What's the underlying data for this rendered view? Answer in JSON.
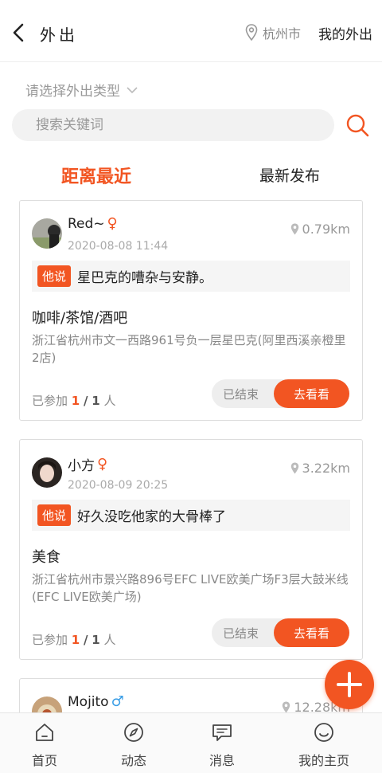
{
  "header": {
    "title": "外出",
    "location": "杭州市",
    "my_outing": "我的外出"
  },
  "type_select": {
    "label": "请选择外出类型"
  },
  "search": {
    "placeholder": "搜索关键词"
  },
  "tabs": [
    {
      "label": "距离最近",
      "active": true
    },
    {
      "label": "最新发布",
      "active": false
    }
  ],
  "cards": [
    {
      "name": "Red~",
      "gender": "♀",
      "time": "2020-08-08 11:44",
      "distance": "0.79km",
      "quote_badge": "他说",
      "quote": "星巴克的嘈杂与安静。",
      "category": "咖啡/茶馆/酒吧",
      "address": "浙江省杭州市文一西路961号负一层星巴克(阿里西溪亲橙里2店)",
      "joined_prefix": "已参加",
      "joined_count": "1",
      "joined_sep": "/",
      "joined_total": "1",
      "joined_unit": "人",
      "status": "已结束",
      "go": "去看看"
    },
    {
      "name": "小方",
      "gender": "♀",
      "time": "2020-08-09 20:25",
      "distance": "3.22km",
      "quote_badge": "他说",
      "quote": "好久没吃他家的大骨棒了",
      "category": "美食",
      "address": "浙江省杭州市景兴路896号EFC LIVE欧美广场F3层大鼓米线(EFC LIVE欧美广场)",
      "joined_prefix": "已参加",
      "joined_count": "1",
      "joined_sep": "/",
      "joined_total": "1",
      "joined_unit": "人",
      "status": "已结束",
      "go": "去看看"
    },
    {
      "name": "Mojito",
      "gender": "♂",
      "distance": "12.28km"
    }
  ],
  "bottom_nav": [
    {
      "label": "首页",
      "icon": "home-icon"
    },
    {
      "label": "动态",
      "icon": "compass-icon"
    },
    {
      "label": "消息",
      "icon": "message-icon"
    },
    {
      "label": "我的主页",
      "icon": "profile-icon"
    }
  ],
  "colors": {
    "accent": "#f25522",
    "male": "#3a9ee6"
  }
}
